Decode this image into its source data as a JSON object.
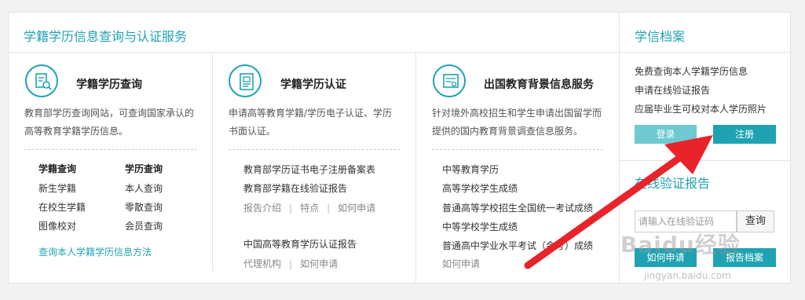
{
  "main": {
    "title": "学籍学历信息查询与认证服务"
  },
  "columns": [
    {
      "title": "学籍学历查询",
      "desc_lines": [
        "教育部学历查询网站，可查询国家承认的",
        "高等教育学籍学历信息。"
      ],
      "grid": {
        "col1_head": "学籍查询",
        "col1": [
          "新生学籍",
          "在校生学籍",
          "图像校对"
        ],
        "col2_head": "学历查询",
        "col2": [
          "本人查询",
          "零散查询",
          "会员查询"
        ]
      },
      "method_link": "查询本人学籍学历信息方法"
    },
    {
      "title": "学籍学历认证",
      "desc_lines": [
        "申请高等教育学籍/学历电子认证、学历",
        "书面认证。"
      ],
      "links": [
        "教育部学历证书电子注册备案表",
        "教育部学籍在线验证报告"
      ],
      "sub1": [
        "报告介绍",
        "特点",
        "如何申请"
      ],
      "report": "中国高等教育学历认证报告",
      "sub2": [
        "代理机构",
        "如何申请"
      ]
    },
    {
      "title": "出国教育背景信息服务",
      "desc_lines": [
        "针对境外高校招生和学生申请出国留学而",
        "提供的国内教育背景调查信息服务。"
      ],
      "items": [
        "中等教育学历",
        "高等学校学生成绩",
        "普通高等学校招生全国统一考试成绩",
        "中等学校学生成绩",
        "普通高中学业水平考试（会考）成绩"
      ],
      "apply": "如何申请"
    }
  ],
  "sidebar": {
    "title": "学信档案",
    "links": [
      "免费查询本人学籍学历信息",
      "申请在线验证报告",
      "应届毕业生可校对本人学历照片"
    ],
    "login": "登录",
    "register": "注册",
    "verify_title": "在线验证报告",
    "verify_placeholder": "请输入在线验证码",
    "verify_button": "查询",
    "btn_how": "如何申请",
    "btn_file": "报告档案"
  },
  "watermark": {
    "text": "Baidu经验",
    "sub": "jingyan.baidu.com"
  },
  "colors": {
    "accent": "#1fa3b3",
    "accent_light": "#6ec9d1",
    "arrow": "#e8232a"
  },
  "icons": [
    "search-doc-icon",
    "certificate-icon",
    "diploma-icon",
    "arrow-annotation"
  ]
}
